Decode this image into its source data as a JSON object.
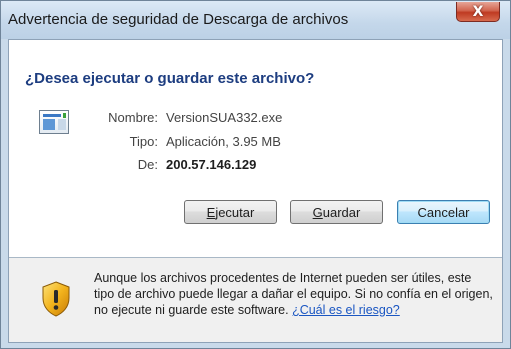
{
  "window": {
    "title": "Advertencia de seguridad de Descarga de archivos",
    "close_label": "X"
  },
  "dialog": {
    "question": "¿Desea ejecutar o guardar este archivo?",
    "fields": [
      {
        "label": "Nombre:",
        "value": "VersionSUA332.exe"
      },
      {
        "label": "Tipo:",
        "value": "Aplicación, 3.95 MB"
      },
      {
        "label": "De:",
        "value": "200.57.146.129"
      }
    ]
  },
  "buttons": {
    "run_label_mnemonic": "E",
    "run_label_rest": "jecutar",
    "save_label_mnemonic": "G",
    "save_label_rest": "uardar",
    "cancel_label": "Cancelar"
  },
  "warning": {
    "text": "Aunque los archivos procedentes de Internet pueden ser útiles, este tipo de archivo puede llegar a dañar el equipo. Si no confía en el origen, no ejecute ni guarde este software.",
    "link": "¿Cuál es el riesgo?"
  },
  "icons": {
    "file": "application-file-icon",
    "warning": "security-shield-warning-icon"
  }
}
